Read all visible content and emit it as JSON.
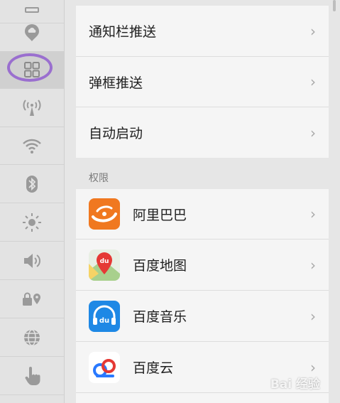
{
  "rail": {
    "items": [
      {
        "icon": "app-grid-icon"
      },
      {
        "icon": "cloud-icon"
      },
      {
        "icon": "apps-grid-icon",
        "selected": true
      },
      {
        "icon": "signal-tower-icon"
      },
      {
        "icon": "wifi-icon"
      },
      {
        "icon": "bluetooth-icon"
      },
      {
        "icon": "brightness-icon"
      },
      {
        "icon": "volume-icon"
      },
      {
        "icon": "lock-location-icon"
      },
      {
        "icon": "globe-icon"
      },
      {
        "icon": "hand-pointer-icon"
      }
    ],
    "highlight_color": "#9a6fcf"
  },
  "settings": {
    "notification_push": "通知栏推送",
    "popup_push": "弹框推送",
    "auto_start": "自动启动",
    "chevron": "›"
  },
  "permissions": {
    "header": "权限",
    "apps": [
      {
        "name": "阿里巴巴",
        "icon": "alibaba-app-icon",
        "color": "#f07820"
      },
      {
        "name": "百度地图",
        "icon": "baidu-map-app-icon",
        "color": "#e53935"
      },
      {
        "name": "百度音乐",
        "icon": "baidu-music-app-icon",
        "color": "#1e88e5"
      },
      {
        "name": "百度云",
        "icon": "baidu-cloud-app-icon",
        "color": "#2979ff"
      }
    ]
  },
  "watermark": "Bai 经验"
}
